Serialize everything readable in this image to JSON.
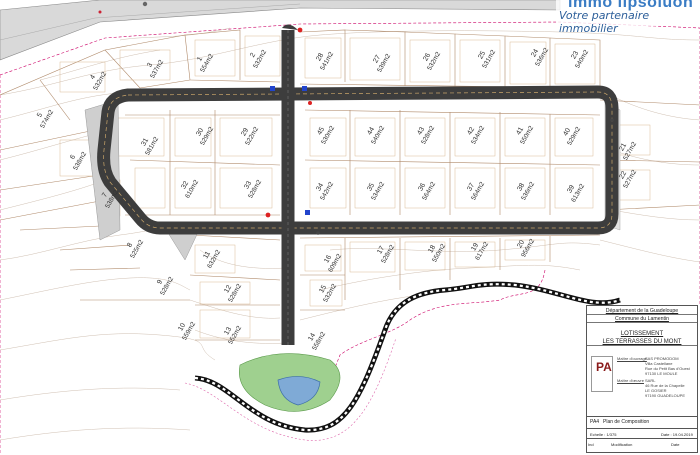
{
  "branding": {
    "logo_text": "immo lipsoluon",
    "tagline": "Votre partenaire immobilier"
  },
  "lots": [
    {
      "num": "1",
      "area": "554m2"
    },
    {
      "num": "2",
      "area": "532m2"
    },
    {
      "num": "3",
      "area": "537m2"
    },
    {
      "num": "4",
      "area": "532m2"
    },
    {
      "num": "5",
      "area": "574m2"
    },
    {
      "num": "6",
      "area": "538m2"
    },
    {
      "num": "7",
      "area": "538m2"
    },
    {
      "num": "8",
      "area": "525m2"
    },
    {
      "num": "9",
      "area": "528m2"
    },
    {
      "num": "10",
      "area": "559m2"
    },
    {
      "num": "11",
      "area": "632m2"
    },
    {
      "num": "12",
      "area": "528m2"
    },
    {
      "num": "13",
      "area": "552m2"
    },
    {
      "num": "14",
      "area": "558m2"
    },
    {
      "num": "15",
      "area": "532m2"
    },
    {
      "num": "16",
      "area": "609m2"
    },
    {
      "num": "17",
      "area": "528m2"
    },
    {
      "num": "18",
      "area": "550m2"
    },
    {
      "num": "19",
      "area": "617m2"
    },
    {
      "num": "20",
      "area": "956m2"
    },
    {
      "num": "21",
      "area": "527m2"
    },
    {
      "num": "22",
      "area": "527m2"
    },
    {
      "num": "23",
      "area": "540m2"
    },
    {
      "num": "24",
      "area": "536m2"
    },
    {
      "num": "25",
      "area": "531m2"
    },
    {
      "num": "26",
      "area": "532m2"
    },
    {
      "num": "27",
      "area": "539m2"
    },
    {
      "num": "28",
      "area": "541m2"
    },
    {
      "num": "29",
      "area": "522m2"
    },
    {
      "num": "30",
      "area": "529m2"
    },
    {
      "num": "31",
      "area": "581m2"
    },
    {
      "num": "32",
      "area": "610m2"
    },
    {
      "num": "33",
      "area": "528m2"
    },
    {
      "num": "34",
      "area": "542m2"
    },
    {
      "num": "35",
      "area": "534m2"
    },
    {
      "num": "36",
      "area": "564m2"
    },
    {
      "num": "37",
      "area": "564m2"
    },
    {
      "num": "38",
      "area": "536m2"
    },
    {
      "num": "39",
      "area": "613m2"
    },
    {
      "num": "40",
      "area": "529m2"
    },
    {
      "num": "41",
      "area": "550m2"
    },
    {
      "num": "42",
      "area": "534m2"
    },
    {
      "num": "43",
      "area": "528m2"
    },
    {
      "num": "44",
      "area": "540m2"
    },
    {
      "num": "45",
      "area": "530m2"
    }
  ],
  "cartouche": {
    "departement": "Département de la Guadeloupe",
    "commune": "Commune du Lamentin",
    "title_line1": "LOTISSEMENT",
    "title_line2": "LES TERRASSES DU MONT",
    "logo_letters": "PA",
    "maitre_label": "Maître d'ouvrage",
    "maitre_lines": [
      "SAS PROMODOM",
      "Villa Castellane",
      "Rue du Petit Bas d'Ouest",
      "97130 LE MOULE"
    ],
    "concepteur_label": "Maître d'œuvre",
    "concepteur_lines": [
      "SARL",
      "46 Rue de la Chapelle",
      "LE GOSIER",
      "97190 GUADELOUPE"
    ],
    "sheet_code": "PA4",
    "sheet_title": "Plan de Composition",
    "scale": "Echelle : 1/375",
    "date": "Date : 19.04.2019",
    "col_indice": "Ind",
    "col_modif": "Modification",
    "col_date": "Date"
  }
}
